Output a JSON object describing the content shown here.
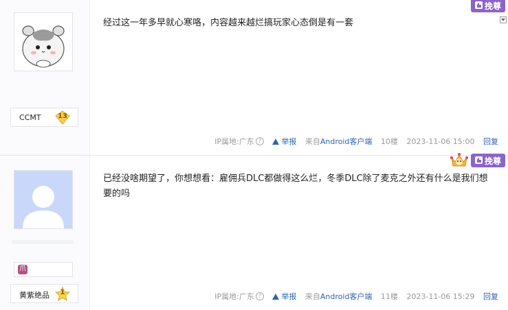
{
  "posts": [
    {
      "username": "CCMT",
      "level": "13",
      "content": "经过这一年多早就心寒咯，内容越来越烂搞玩家心态倒是有一套",
      "zun_label": "挽尊",
      "ip_label": "IP属地:广东",
      "report_label": "举报",
      "client_prefix": "来自",
      "client_link": "Android客户端",
      "floor": "10楼",
      "time": "2023-11-06 15:00",
      "reply_label": "回复"
    },
    {
      "username": "黄紫绝品",
      "level": "1",
      "medal_text": "爪",
      "content": "已经没啥期望了，你想想看：雇佣兵DLC都做得这么烂，冬季DLC除了麦克之外还有什么是我们想要的吗",
      "zun_label": "挽尊",
      "ip_label": "IP属地:广东",
      "report_label": "举报",
      "client_prefix": "来自",
      "client_link": "Android客户端",
      "floor": "11楼",
      "time": "2023-11-06 15:29",
      "reply_label": "回复"
    }
  ],
  "colors": {
    "accent_purple": "#8d63c9",
    "link_blue": "#2d64b3",
    "meta_gray": "#999999"
  }
}
